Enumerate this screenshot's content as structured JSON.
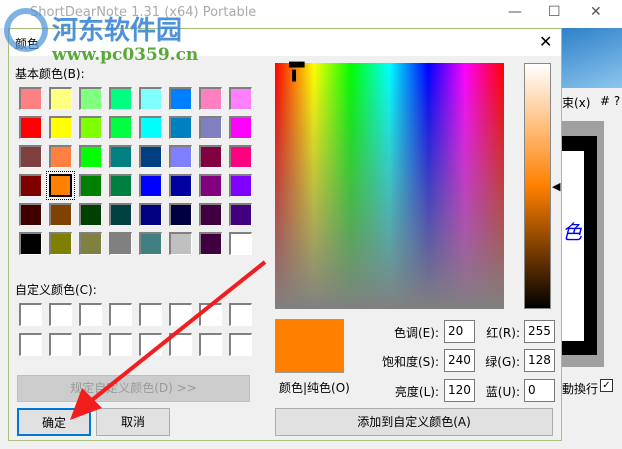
{
  "app": {
    "title": "ShortDearNote 1.31 (x64) Portable",
    "menu_frag": "束(x)",
    "help": "# ?",
    "wrap_label": "動換行",
    "canvas_text": "色"
  },
  "watermark": {
    "name": "河东软件园",
    "url": "www.pc0359.cn"
  },
  "dialog": {
    "title": "颜色",
    "basic_label": "基本颜色(B):",
    "custom_label": "自定义颜色(C):",
    "basic_colors": [
      "#ff8080",
      "#ffff80",
      "#80ff80",
      "#00ff80",
      "#80ffff",
      "#0080ff",
      "#ff80c0",
      "#ff80ff",
      "#ff0000",
      "#ffff00",
      "#80ff00",
      "#00ff40",
      "#00ffff",
      "#0080c0",
      "#8080c0",
      "#ff00ff",
      "#804040",
      "#ff8040",
      "#00ff00",
      "#008080",
      "#004080",
      "#8080ff",
      "#800040",
      "#ff0080",
      "#800000",
      "#ff8000",
      "#008000",
      "#008040",
      "#0000ff",
      "#0000a0",
      "#800080",
      "#8000ff",
      "#400000",
      "#804000",
      "#004000",
      "#004040",
      "#000080",
      "#000040",
      "#400040",
      "#400080",
      "#000000",
      "#808000",
      "#808040",
      "#808080",
      "#408080",
      "#c0c0c0",
      "#400040",
      "#ffffff"
    ],
    "selected_index": 25,
    "define_button": "规定自定义颜色(D) >>",
    "ok_button": "确定",
    "cancel_button": "取消",
    "preview_label": "颜色|纯色(O)",
    "preview_color": "#ff8000",
    "hue_label": "色调(E):",
    "hue": "20",
    "sat_label": "饱和度(S):",
    "sat": "240",
    "lum_label": "亮度(L):",
    "lum": "120",
    "red_label": "红(R):",
    "red": "255",
    "green_label": "绿(G):",
    "green": "128",
    "blue_label": "蓝(U):",
    "blue": "0",
    "add_button": "添加到自定义颜色(A)"
  }
}
